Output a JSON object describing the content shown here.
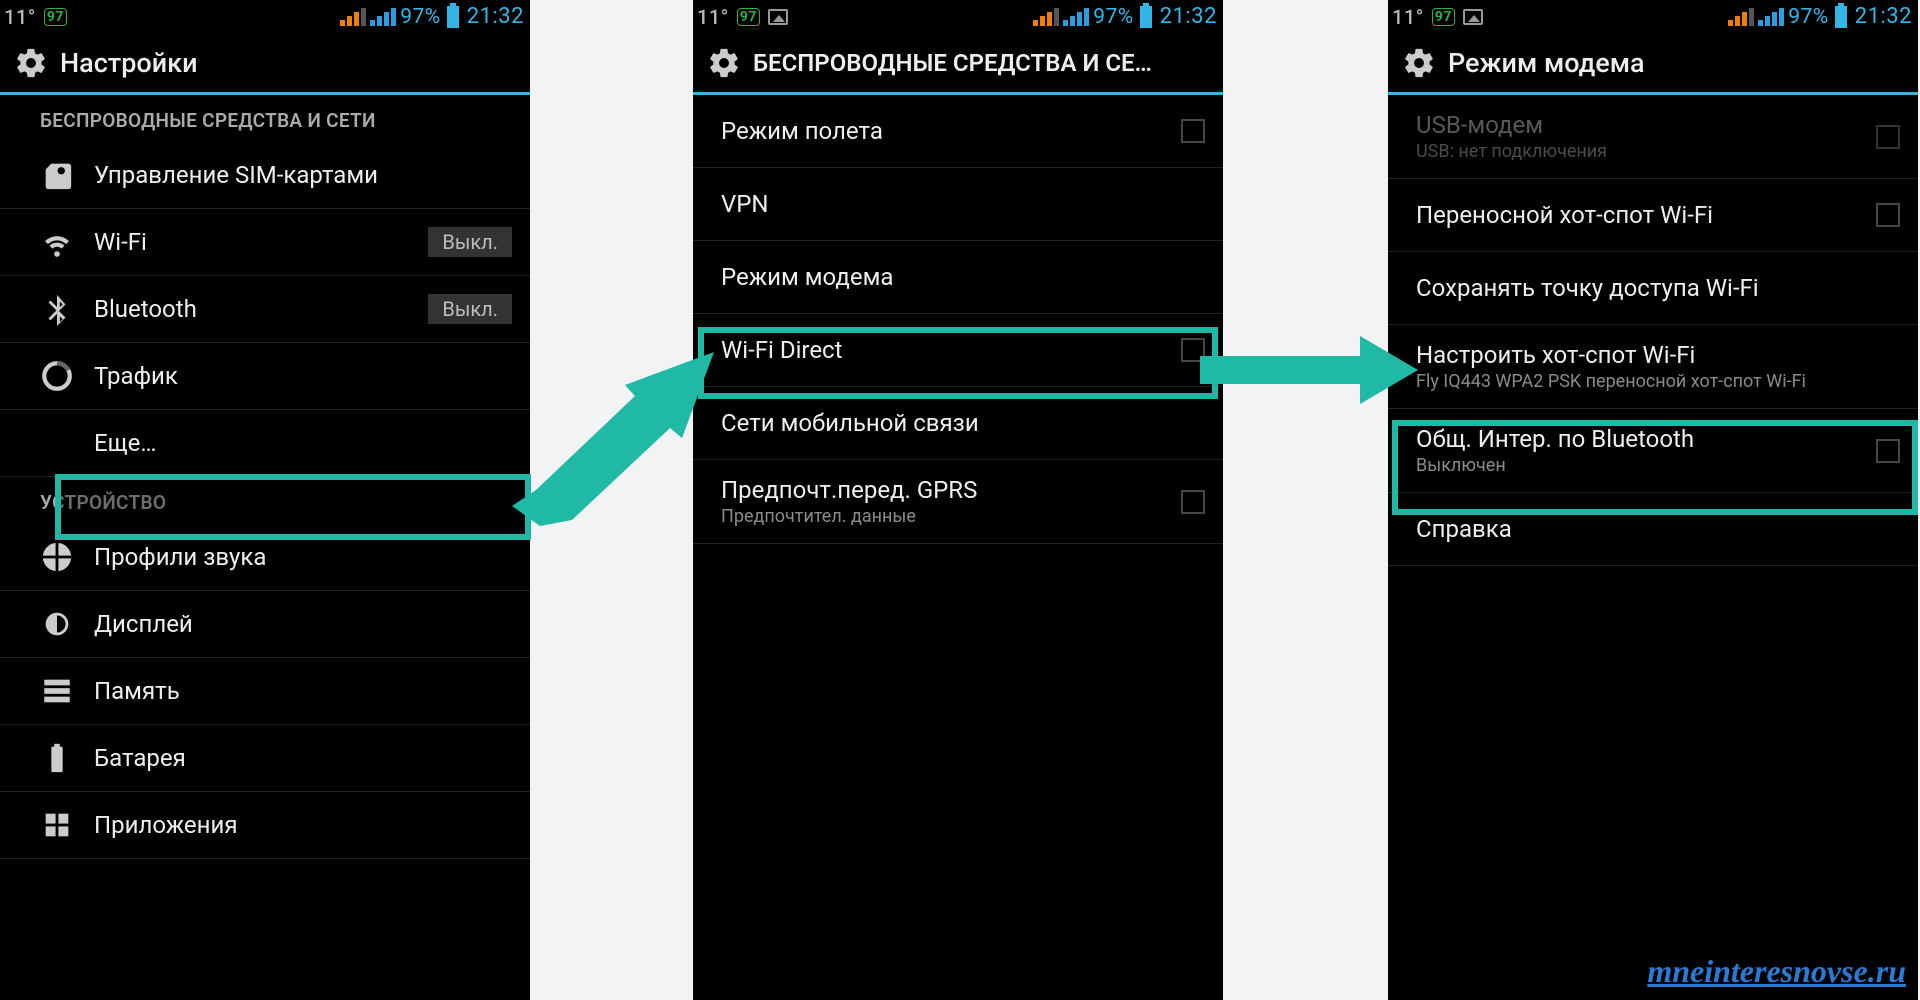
{
  "status": {
    "temp": "11°",
    "badge": "97",
    "percent": "97%",
    "time": "21:32"
  },
  "p1": {
    "title": "Настройки",
    "sec_wireless": "БЕСПРОВОДНЫЕ СРЕДСТВА И СЕТИ",
    "sim": "Управление SIM-картами",
    "wifi": "Wi-Fi",
    "wifi_state": "Выкл.",
    "bt": "Bluetooth",
    "bt_state": "Выкл.",
    "traffic": "Трафик",
    "more": "Еще…",
    "sec_device": "УСТРОЙСТВО",
    "sound": "Профили звука",
    "display": "Дисплей",
    "storage": "Память",
    "battery": "Батарея",
    "apps": "Приложения"
  },
  "p2": {
    "title": "БЕСПРОВОДНЫЕ СРЕДСТВА И СЕ…",
    "airplane": "Режим полета",
    "vpn": "VPN",
    "tether": "Режим модема",
    "wifidirect": "Wi-Fi Direct",
    "mobile": "Сети мобильной связи",
    "gprs": "Предпочт.перед. GPRS",
    "gprs_sub": "Предпочтител. данные"
  },
  "p3": {
    "title": "Режим модема",
    "usb": "USB-модем",
    "usb_sub": "USB: нет подключения",
    "hotspot": "Переносной хот-спот Wi-Fi",
    "keep": "Сохранять точку доступа Wi-Fi",
    "configure": "Настроить хот-спот Wi-Fi",
    "configure_sub": "Fly IQ443 WPA2 PSK переносной хот-спот Wi-Fi",
    "btshare": "Общ. Интер. по Bluetooth",
    "btshare_sub": "Выключен",
    "help": "Справка"
  },
  "watermark": "mneinteresnovse.ru",
  "colors": {
    "accent": "#33b5e5",
    "highlight": "#1fb8a5"
  }
}
